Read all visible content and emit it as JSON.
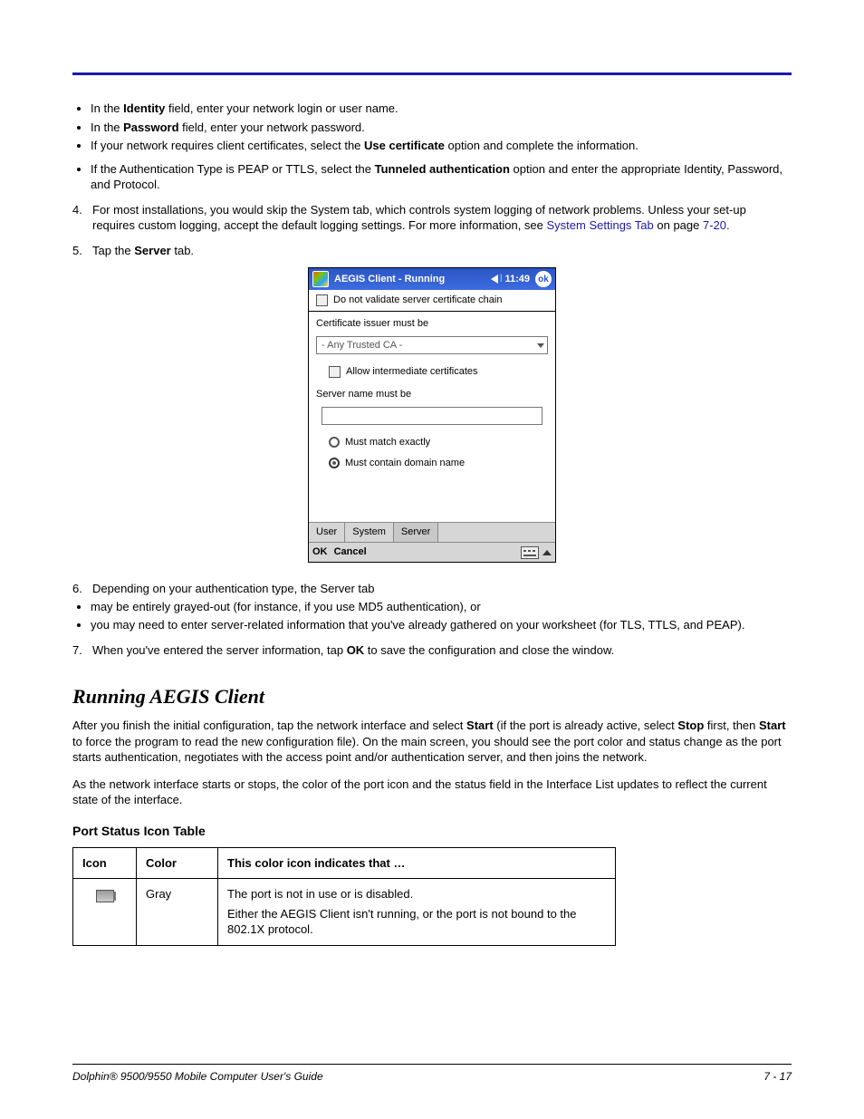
{
  "bullets_top": [
    {
      "pre": "In the ",
      "bold": "Identity",
      "post": " field, enter your network login or user name."
    },
    {
      "pre": "In the ",
      "bold": "Password",
      "post": " field, enter your network password."
    },
    {
      "pre": "If your network requires client certificates, select the ",
      "bold": "Use certificate",
      "post": " option and complete the information."
    },
    {
      "pre": "If the Authentication Type is PEAP or TTLS, select the ",
      "bold": "Tunneled authentication",
      "post": " option and enter the appropriate Identity, Password, and Protocol."
    }
  ],
  "step4": {
    "num": "4.",
    "text_a": "For most installations, you would skip the System tab, which controls system logging of network problems. Unless your set-up requires custom logging, accept the default logging settings. For more information, see ",
    "link": "System Settings Tab",
    "text_b": " on page ",
    "pagelink": "7-20.",
    "tail": ""
  },
  "step5": {
    "num": "5.",
    "pre": "Tap the ",
    "bold": "Server",
    "post": " tab."
  },
  "screenshot": {
    "title": "AEGIS Client - Running",
    "time": "11:49",
    "ok": "ok",
    "chk_no_validate": "Do not validate server certificate chain",
    "lbl_issuer": "Certificate issuer must be",
    "sel_issuer": "- Any Trusted CA -",
    "chk_intermediate": "Allow intermediate certificates",
    "lbl_server": "Server name must be",
    "radio_exact": "Must match exactly",
    "radio_domain": "Must contain domain name",
    "tabs": [
      "User",
      "System",
      "Server"
    ],
    "footer_ok": "OK",
    "footer_cancel": "Cancel"
  },
  "step6": {
    "num": "6.",
    "intro": "Depending on your authentication type, the Server tab",
    "bullets": [
      "may be entirely grayed-out (for instance, if you use MD5 authentication), or",
      "you may need to enter server-related information that you've already gathered on your worksheet (for TLS, TTLS, and PEAP)."
    ]
  },
  "step7": {
    "num": "7.",
    "pre": "When you've entered the server information, tap ",
    "bold": "OK",
    "post": " to save the configuration and close the window."
  },
  "heading": "Running AEGIS Client",
  "para1": {
    "a": "After you finish the initial configuration, tap the network interface and select ",
    "b1": "Start",
    "c": " (if the port is already active, select ",
    "b2": "Stop",
    "d": " first, then ",
    "b3": "Start",
    "e": " to force the program to read the new configuration file). On the main screen, you should see the port color and status change as the port starts authentication, negotiates with the access point and/or authentication server, and then joins the network."
  },
  "para2": "As the network interface starts or stops, the color of the port icon and the status field in the Interface List updates to reflect the current state of the interface.",
  "table_title": "Port Status Icon Table",
  "table": {
    "h1": "Icon",
    "h2": "Color",
    "h3": "This color icon indicates that …",
    "r1_color": "Gray",
    "r1_line1": "The port is not in use or is disabled.",
    "r1_line2": "Either the AEGIS Client isn't running, or the port is not bound to the 802.1X protocol."
  },
  "footer_left": "Dolphin® 9500/9550 Mobile Computer User's Guide",
  "footer_right": "7 - 17"
}
